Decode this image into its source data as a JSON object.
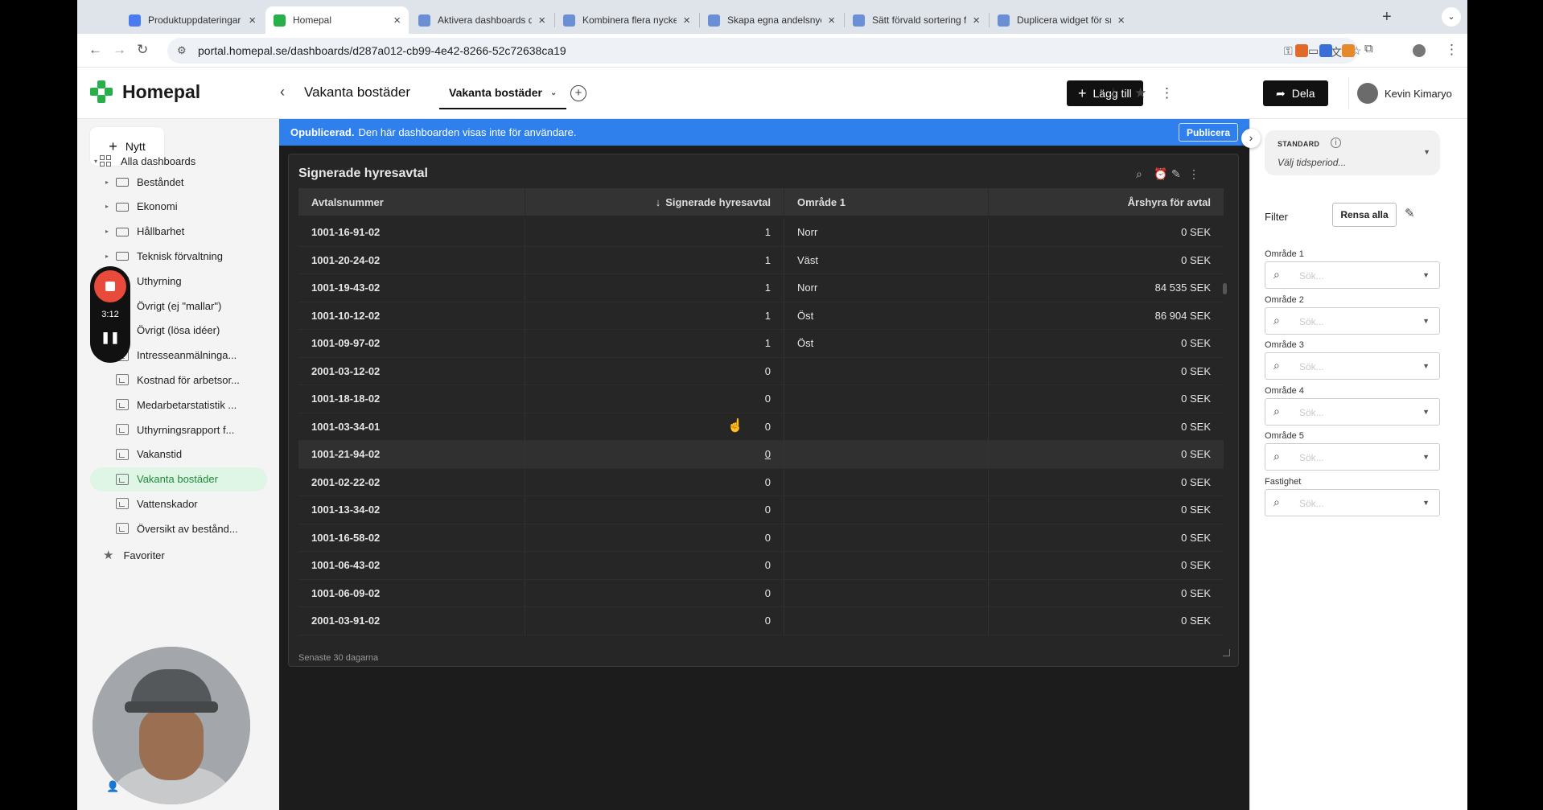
{
  "browser": {
    "tabs": [
      {
        "title": "Produktuppdateringar sept",
        "favicon_color": "#4a7cf0"
      },
      {
        "title": "Homepal",
        "favicon_color": "#27b04a"
      },
      {
        "title": "Aktivera dashboards direkt",
        "favicon_color": "#6b8fd4"
      },
      {
        "title": "Kombinera flera nyckeltal i",
        "favicon_color": "#6b8fd4"
      },
      {
        "title": "Skapa egna andelsnyckeltal",
        "favicon_color": "#6b8fd4"
      },
      {
        "title": "Sätt förvald sortering för b",
        "favicon_color": "#6b8fd4"
      },
      {
        "title": "Duplicera widget för snabb",
        "favicon_color": "#6b8fd4"
      }
    ],
    "active_tab": 1,
    "url": "portal.homepal.se/dashboards/d287a012-cb99-4e42-8266-52c72638ca19"
  },
  "header": {
    "app_name": "Homepal",
    "dashboard_title": "Vakanta bostäder",
    "dashboard_tab": "Vakanta bostäder",
    "add_button": "Lägg till",
    "share_button": "Dela",
    "user_name": "Kevin Kimaryo",
    "brand_color": "#27b04a"
  },
  "sidebar": {
    "new_button": "Nytt",
    "root": "Alla dashboards",
    "items": [
      {
        "label": "Beståndet",
        "type": "folder"
      },
      {
        "label": "Ekonomi",
        "type": "folder"
      },
      {
        "label": "Hållbarhet",
        "type": "folder"
      },
      {
        "label": "Teknisk förvaltning",
        "type": "folder"
      },
      {
        "label": "Uthyrning",
        "type": "folder"
      },
      {
        "label": "Övrigt (ej \"mallar\")",
        "type": "folder"
      },
      {
        "label": "Övrigt (lösa idéer)",
        "type": "folder"
      },
      {
        "label": "Intresseanmälninga...",
        "type": "dashboard"
      },
      {
        "label": "Kostnad för arbetsor...",
        "type": "dashboard"
      },
      {
        "label": "Medarbetarstatistik ...",
        "type": "dashboard"
      },
      {
        "label": "Uthyrningsrapport f...",
        "type": "dashboard"
      },
      {
        "label": "Vakanstid",
        "type": "dashboard"
      },
      {
        "label": "Vakanta bostäder",
        "type": "dashboard",
        "active": true
      },
      {
        "label": "Vattenskador",
        "type": "dashboard"
      },
      {
        "label": "Översikt av bestånd...",
        "type": "dashboard"
      }
    ],
    "favorites": "Favoriter",
    "recorder_time": "3:12"
  },
  "banner": {
    "bold": "Opublicerad.",
    "text": "Den här dashboarden visas inte för användare.",
    "publish_button": "Publicera"
  },
  "widget": {
    "title": "Signerade hyresavtal",
    "columns": [
      "Avtalsnummer",
      "Signerade hyresavtal",
      "Område 1",
      "Årshyra för avtal"
    ],
    "sort_indicator": "↓",
    "rows": [
      [
        "1001-16-91-02",
        "1",
        "Norr",
        "0 SEK"
      ],
      [
        "1001-20-24-02",
        "1",
        "Väst",
        "0 SEK"
      ],
      [
        "1001-19-43-02",
        "1",
        "Norr",
        "84 535 SEK"
      ],
      [
        "1001-10-12-02",
        "1",
        "Öst",
        "86 904 SEK"
      ],
      [
        "1001-09-97-02",
        "1",
        "Öst",
        "0 SEK"
      ],
      [
        "2001-03-12-02",
        "0",
        "",
        "0 SEK"
      ],
      [
        "1001-18-18-02",
        "0",
        "",
        "0 SEK"
      ],
      [
        "1001-03-34-01",
        "0",
        "",
        "0 SEK"
      ],
      [
        "1001-21-94-02",
        "0",
        "",
        "0 SEK"
      ],
      [
        "2001-02-22-02",
        "0",
        "",
        "0 SEK"
      ],
      [
        "1001-13-34-02",
        "0",
        "",
        "0 SEK"
      ],
      [
        "1001-16-58-02",
        "0",
        "",
        "0 SEK"
      ],
      [
        "1001-06-43-02",
        "0",
        "",
        "0 SEK"
      ],
      [
        "1001-06-09-02",
        "0",
        "",
        "0 SEK"
      ],
      [
        "2001-03-91-02",
        "0",
        "",
        "0 SEK"
      ]
    ],
    "hover_row": 8,
    "footer": "Senaste 30 dagarna"
  },
  "right_panel": {
    "period_label": "STANDARD",
    "period_placeholder": "Välj tidsperiod...",
    "filter_label": "Filter",
    "clear_button": "Rensa alla",
    "filters": [
      {
        "label": "Område 1",
        "placeholder": "Sök..."
      },
      {
        "label": "Område 2",
        "placeholder": "Sök..."
      },
      {
        "label": "Område 3",
        "placeholder": "Sök..."
      },
      {
        "label": "Område 4",
        "placeholder": "Sök..."
      },
      {
        "label": "Område 5",
        "placeholder": "Sök..."
      },
      {
        "label": "Fastighet",
        "placeholder": "Sök..."
      }
    ]
  }
}
